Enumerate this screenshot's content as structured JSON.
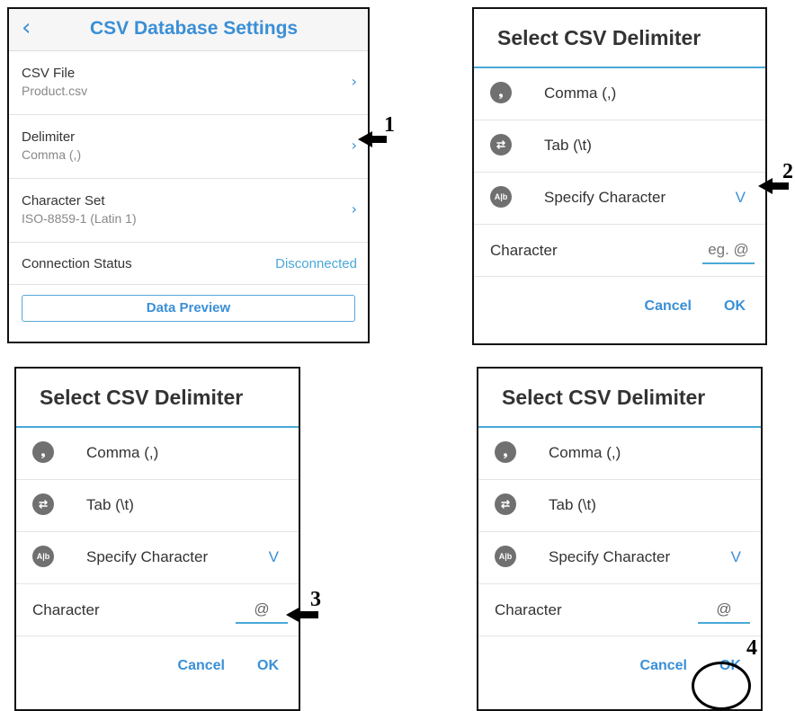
{
  "settings": {
    "title": "CSV Database Settings",
    "back_icon": "‹",
    "rows": [
      {
        "label": "CSV File",
        "value": "Product.csv"
      },
      {
        "label": "Delimiter",
        "value": "Comma (,)"
      },
      {
        "label": "Character Set",
        "value": "ISO-8859-1 (Latin 1)"
      }
    ],
    "connection_label": "Connection Status",
    "connection_value": "Disconnected",
    "preview_label": "Data Preview",
    "chevron": "›"
  },
  "dialog": {
    "title": "Select CSV Delimiter",
    "options": [
      {
        "label": "Comma (,)",
        "icon": "comma-icon",
        "glyph": "❟"
      },
      {
        "label": "Tab (\\t)",
        "icon": "tab-icon",
        "glyph": "⇄"
      },
      {
        "label": "Specify Character",
        "icon": "specify-character-icon",
        "glyph": "A|b"
      }
    ],
    "check": "V",
    "character_label": "Character",
    "cancel": "Cancel",
    "ok": "OK"
  },
  "panels": [
    {
      "id": "dialog-1",
      "field_value": "",
      "field_placeholder": "eg. @"
    },
    {
      "id": "dialog-2",
      "field_value": "@",
      "field_placeholder": "eg. @"
    },
    {
      "id": "dialog-3",
      "field_value": "@",
      "field_placeholder": "eg. @"
    }
  ],
  "steps": [
    "1",
    "2",
    "3",
    "4"
  ],
  "colors": {
    "accent": "#3a8fd6",
    "underline": "#4aa8d8",
    "icon_bg": "#707070"
  }
}
